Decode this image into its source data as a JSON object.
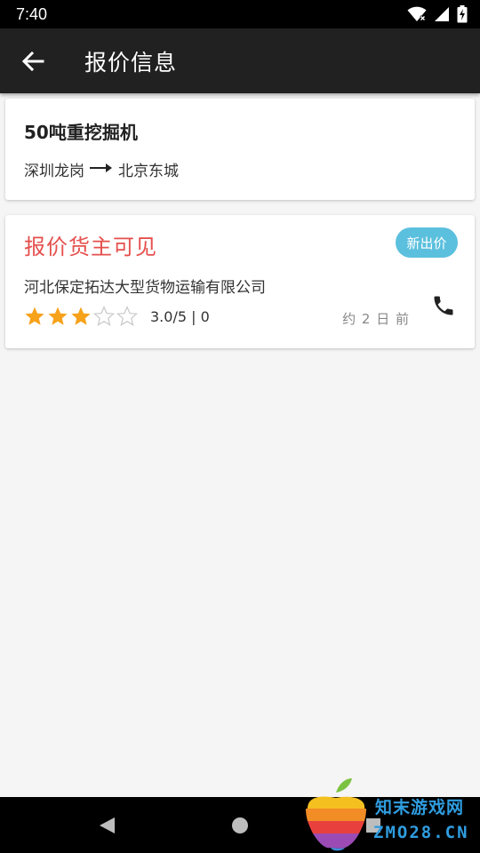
{
  "status_bar": {
    "time": "7:40",
    "icons": [
      "wifi-icon",
      "signal-icon",
      "battery-icon"
    ]
  },
  "app_bar": {
    "back_icon": "arrow-left-icon",
    "title": "报价信息"
  },
  "goods": {
    "name": "50吨重挖掘机",
    "origin": "深圳龙岗",
    "arrow_icon": "arrow-right-icon",
    "destination": "北京东城"
  },
  "quote": {
    "title": "报价货主可见",
    "badge": "新出价",
    "company": "河北保定拓达大型货物运输有限公司",
    "rating": {
      "value": 3,
      "max": 5,
      "text": "3.0/5 | 0"
    },
    "time_ago": "约 2 日 前",
    "phone_icon": "phone-icon"
  },
  "nav_bar": {
    "icons": [
      "nav-back-icon",
      "nav-home-icon",
      "nav-recent-icon"
    ]
  },
  "watermark": {
    "line1": "知末游戏网",
    "line2": "ZMO28.CN"
  },
  "colors": {
    "app_bar": "#212121",
    "quote_title": "#e5504d",
    "badge": "#5bc0de",
    "star_filled": "#f7a21b",
    "star_empty": "#c8c8c8",
    "watermark": "#2f9de0"
  }
}
